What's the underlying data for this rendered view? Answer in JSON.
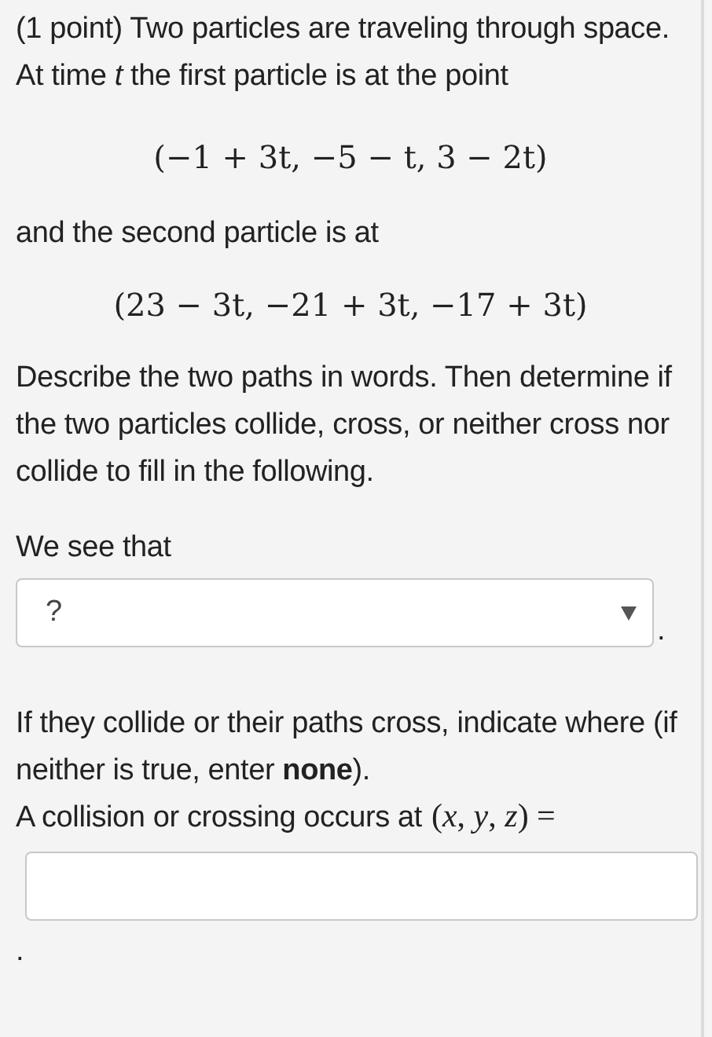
{
  "intro": "(1 point) Two particles are traveling through space. At time *t* the first particle is at the point",
  "first_point": "(−1 + 3t, −5 − t, 3 − 2t)",
  "between": "and the second particle is at",
  "second_point": "(23 − 3t, −21 + 3t, −17 + 3t)",
  "instructions": "Describe the two paths in words. Then determine if the two particles collide, cross, or neither cross nor collide to fill in the following.",
  "select_label": "We see that",
  "select": {
    "value": "?",
    "trailing": "."
  },
  "where_text": "If they collide or their paths cross, indicate where (if neither is true, enter **none**).",
  "answer_label": "A collision or crossing occurs at",
  "answer_math": "(*x*, *y*, *z*) =",
  "answer_trailing": "."
}
